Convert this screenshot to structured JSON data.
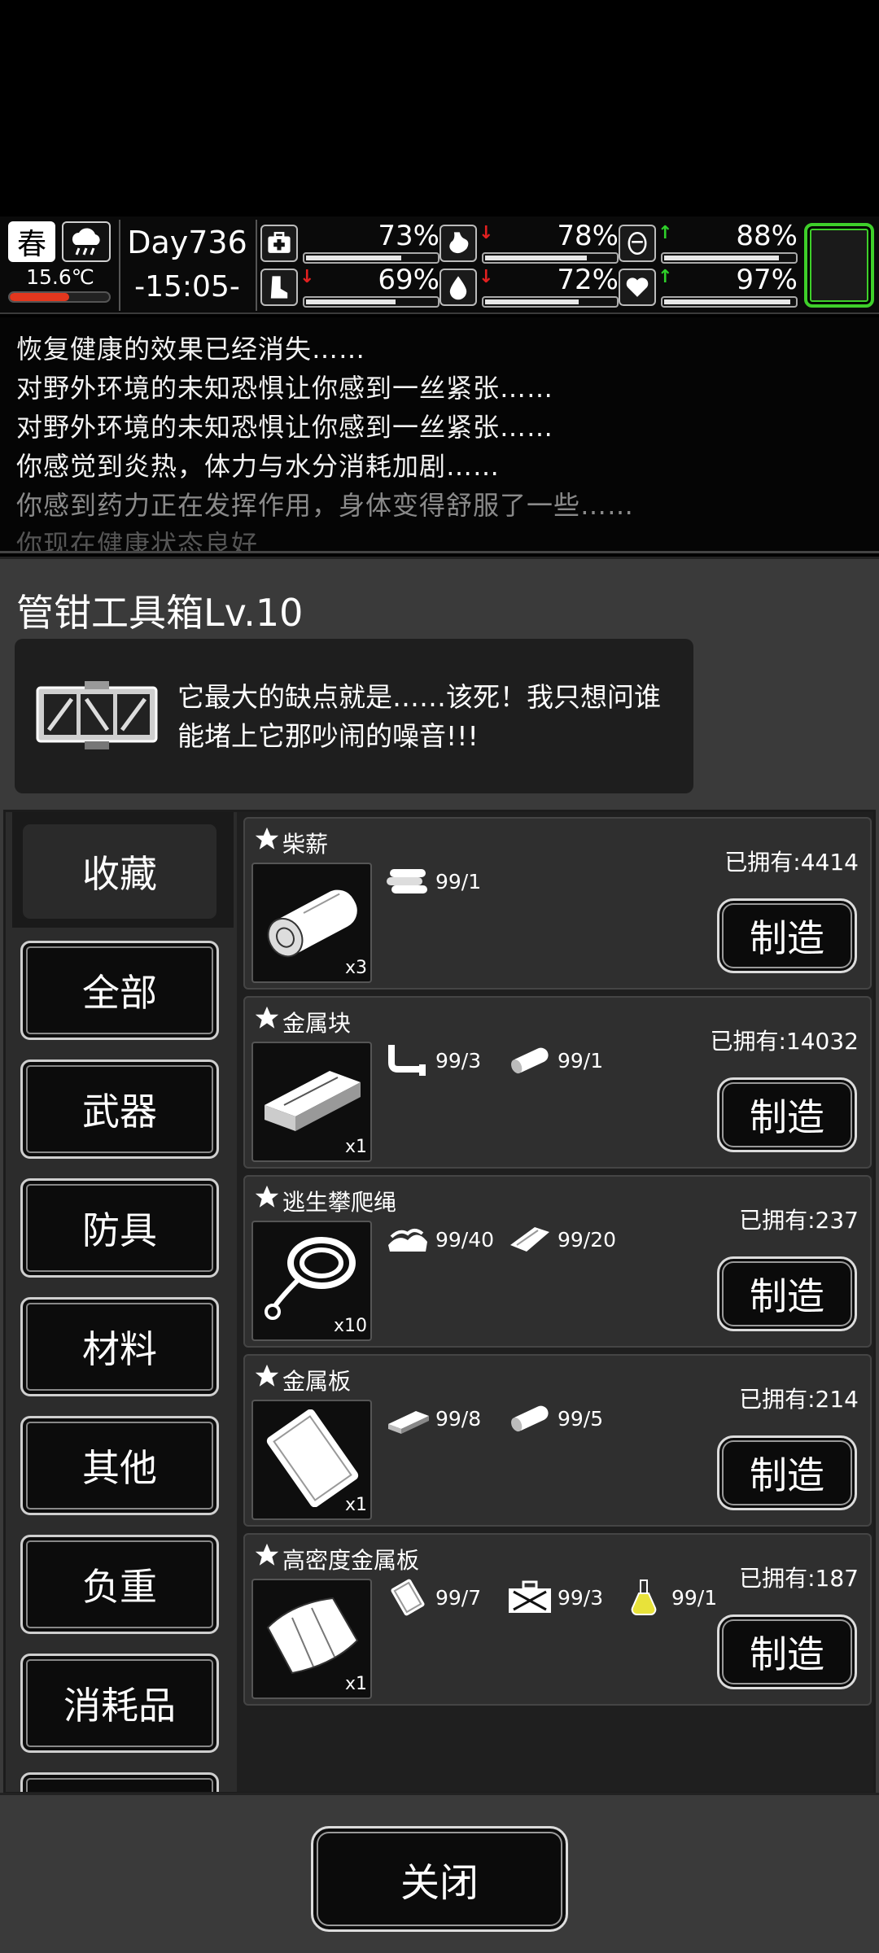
{
  "status": {
    "season": "春",
    "temperature": "15.6℃",
    "temperature_level": 0.6,
    "day": "Day736",
    "time": "-15:05-",
    "stats": [
      {
        "key": "health",
        "icon": "medkit-icon",
        "arrow": "",
        "arrow_color": "",
        "value": "73%",
        "level": 0.73
      },
      {
        "key": "hunger",
        "icon": "stomach-icon",
        "arrow": "↓",
        "arrow_color": "#e32020",
        "value": "78%",
        "level": 0.78
      },
      {
        "key": "mood",
        "icon": "face-icon",
        "arrow": "↑",
        "arrow_color": "#2fd12a",
        "value": "88%",
        "level": 0.88
      },
      {
        "key": "stamina",
        "icon": "boot-icon",
        "arrow": "↓",
        "arrow_color": "#e32020",
        "value": "69%",
        "level": 0.69
      },
      {
        "key": "water",
        "icon": "water-drop-icon",
        "arrow": "↓",
        "arrow_color": "#e32020",
        "value": "72%",
        "level": 0.72
      },
      {
        "key": "heart",
        "icon": "heart-icon",
        "arrow": "↑",
        "arrow_color": "#2fd12a",
        "value": "97%",
        "level": 0.97
      }
    ]
  },
  "log": [
    {
      "text": "恢复健康的效果已经消失……",
      "color": "#f2f2f2"
    },
    {
      "text": "对野外环境的未知恐惧让你感到一丝紧张……",
      "color": "#f2f2f2"
    },
    {
      "text": "对野外环境的未知恐惧让你感到一丝紧张……",
      "color": "#f2f2f2"
    },
    {
      "text": "你感觉到炎热，体力与水分消耗加剧……",
      "color": "#f2f2f2"
    },
    {
      "text": "你感到药力正在发挥作用，身体变得舒服了一些……",
      "color": "#8a8a8a"
    },
    {
      "text": "你现在健康状态良好",
      "color": "#555555"
    }
  ],
  "panel": {
    "title": "管钳工具箱Lv.10",
    "description": "它最大的缺点就是……该死！我只想问谁能堵上它那吵闹的噪音!!!"
  },
  "categories": [
    {
      "label": "收藏",
      "active": true
    },
    {
      "label": "全部",
      "active": false
    },
    {
      "label": "武器",
      "active": false
    },
    {
      "label": "防具",
      "active": false
    },
    {
      "label": "材料",
      "active": false
    },
    {
      "label": "其他",
      "active": false
    },
    {
      "label": "负重",
      "active": false
    },
    {
      "label": "消耗品",
      "active": false
    }
  ],
  "items": [
    {
      "name": "柴薪",
      "owned": "已拥有:4414",
      "qty": "x3",
      "image": "firewood-icon",
      "materials": [
        {
          "icon": "logs-icon",
          "text": "99/1"
        }
      ],
      "button": "制造"
    },
    {
      "name": "金属块",
      "owned": "已拥有:14032",
      "qty": "x1",
      "image": "metal-block-icon",
      "materials": [
        {
          "icon": "pipe-icon",
          "text": "99/3"
        },
        {
          "icon": "log-icon",
          "text": "99/1"
        }
      ],
      "button": "制造"
    },
    {
      "name": "逃生攀爬绳",
      "owned": "已拥有:237",
      "qty": "x10",
      "image": "rope-icon",
      "materials": [
        {
          "icon": "cloth-pile-icon",
          "text": "99/40"
        },
        {
          "icon": "cloth-icon",
          "text": "99/20"
        }
      ],
      "button": "制造"
    },
    {
      "name": "金属板",
      "owned": "已拥有:214",
      "qty": "x1",
      "image": "metal-plate-icon",
      "materials": [
        {
          "icon": "metal-block-icon",
          "text": "99/8"
        },
        {
          "icon": "log-icon",
          "text": "99/5"
        }
      ],
      "button": "制造"
    },
    {
      "name": "高密度金属板",
      "owned": "已拥有:187",
      "qty": "x1",
      "image": "dense-metal-plate-icon",
      "materials": [
        {
          "icon": "metal-plate-icon",
          "text": "99/7"
        },
        {
          "icon": "toolbox-icon",
          "text": "99/3"
        },
        {
          "icon": "flask-icon",
          "text": "99/1"
        }
      ],
      "button": "制造"
    }
  ],
  "close_label": "关闭"
}
